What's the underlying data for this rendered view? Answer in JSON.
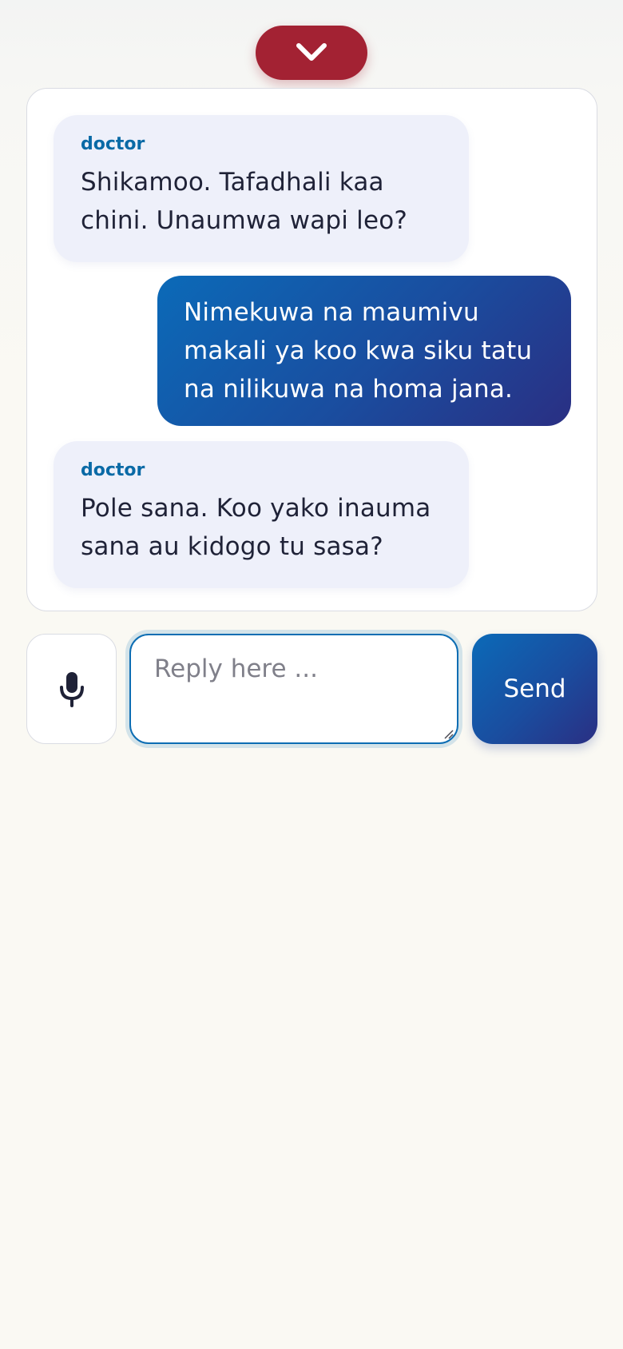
{
  "header": {
    "collapse_icon": "chevron-down-icon"
  },
  "conversation": {
    "messages": [
      {
        "sender": "doctor",
        "text": "Shikamoo. Tafadhali kaa chini. Unaumwa wapi leo?"
      },
      {
        "sender": "",
        "text": "Nimekuwa na maumivu makali ya koo kwa siku tatu na nilikuwa na homa jana."
      },
      {
        "sender": "doctor",
        "text": "Pole sana. Koo yako inauma sana au kidogo tu sasa?"
      }
    ]
  },
  "composer": {
    "mic_icon": "microphone-icon",
    "reply_placeholder": "Reply here ...",
    "reply_value": "",
    "send_label": "Send"
  },
  "colors": {
    "collapse_button": "#a32233",
    "doctor_bubble": "#eef0fa",
    "doctor_label": "#0a6aa6",
    "user_bubble_start": "#0b6ab8",
    "user_bubble_end": "#2a2f83",
    "page_background": "#faf9f3"
  }
}
